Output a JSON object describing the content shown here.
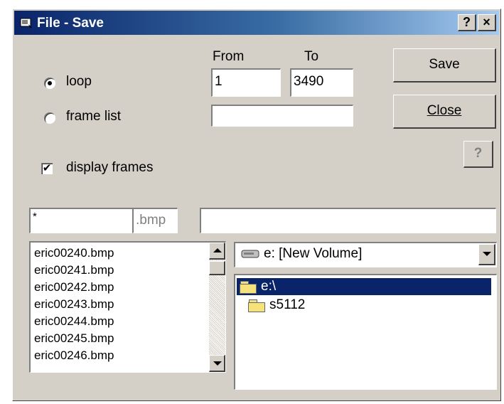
{
  "window": {
    "title": "File - Save",
    "help_button": "?",
    "close_button": "×"
  },
  "mode": {
    "loop_label": "loop",
    "frame_list_label": "frame list",
    "selected": "loop"
  },
  "range": {
    "from_label": "From",
    "to_label": "To",
    "from_value": "1",
    "to_value": "3490",
    "frame_list_value": ""
  },
  "display_frames": {
    "label": "display frames",
    "checked": true
  },
  "buttons": {
    "save": "Save",
    "close": "Close",
    "help_glyph": "?"
  },
  "filename": {
    "pattern": "*",
    "extension": ".bmp",
    "full_path": ""
  },
  "files": [
    {
      "name": "eric00240.bmp"
    },
    {
      "name": "eric00241.bmp"
    },
    {
      "name": "eric00242.bmp"
    },
    {
      "name": "eric00243.bmp"
    },
    {
      "name": "eric00244.bmp"
    },
    {
      "name": "eric00245.bmp"
    },
    {
      "name": "eric00246.bmp"
    }
  ],
  "drive": {
    "selected": "e: [New Volume]"
  },
  "directories": [
    {
      "name": "e:\\",
      "selected": true
    },
    {
      "name": "s5112",
      "selected": false
    }
  ],
  "colors": {
    "selection": "#0a246a",
    "face": "#d4d0c8",
    "title_start": "#0a246a",
    "title_end": "#a6caf0"
  }
}
